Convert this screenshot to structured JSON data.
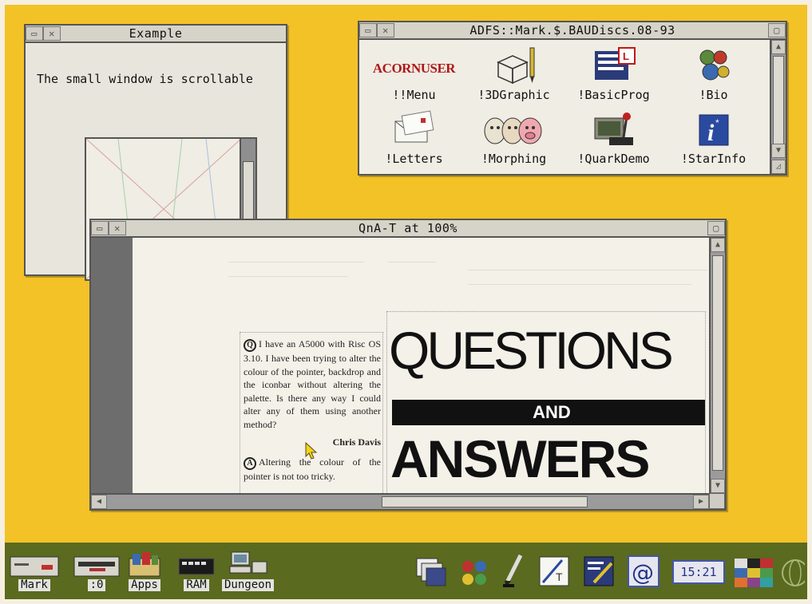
{
  "desktop": {
    "background_color": "#f2c227"
  },
  "example_window": {
    "title": "Example",
    "message": "The small window is scrollable"
  },
  "filer_window": {
    "title": "ADFS::Mark.$.BAUDiscs.08-93",
    "logo_text": "ACORNUSER",
    "items": [
      {
        "label": "!!Menu",
        "icon": "acorn-user-logo"
      },
      {
        "label": "!3DGraphic",
        "icon": "wireframe-box-pencil-icon"
      },
      {
        "label": "!BasicProg",
        "icon": "basic-program-icon"
      },
      {
        "label": "!Bio",
        "icon": "gears-icon"
      },
      {
        "label": "!Letters",
        "icon": "envelope-letters-icon"
      },
      {
        "label": "!Morphing",
        "icon": "morphing-faces-icon"
      },
      {
        "label": "!QuarkDemo",
        "icon": "joystick-icon"
      },
      {
        "label": "!StarInfo",
        "icon": "info-icon"
      }
    ]
  },
  "draw_window": {
    "title": "QnA-T at 100%",
    "article": {
      "question_marker": "Q",
      "question": "I have an A5000 with Risc OS 3.10. I have been trying to alter the colour of the pointer, backdrop and the iconbar without altering the palette. Is there any way I could alter any of them using another method?",
      "author": "Chris Davis",
      "answer_marker": "A",
      "answer": "Altering the colour of the pointer is not too tricky."
    },
    "heading": {
      "line1": "QUESTIONS",
      "line2": "AND",
      "line3": "ANSWERS"
    }
  },
  "iconbar": {
    "left_items": [
      {
        "label": "Mark",
        "icon": "floppy-drive-icon"
      },
      {
        "label": ":0",
        "icon": "disc-drive-icon"
      },
      {
        "label": "Apps",
        "icon": "apps-folder-icon"
      },
      {
        "label": "RAM",
        "icon": "ram-disc-icon"
      },
      {
        "label": "Dungeon",
        "icon": "network-computer-icon"
      }
    ],
    "right_items": [
      {
        "icon": "windows-stack-icon"
      },
      {
        "icon": "paint-palette-icon"
      },
      {
        "icon": "pen-nib-icon"
      },
      {
        "icon": "draw-icon"
      },
      {
        "icon": "edit-icon"
      },
      {
        "icon": "at-sign-icon"
      },
      {
        "icon": "palette-icon"
      },
      {
        "icon": "globe-icon"
      }
    ],
    "clock": "15:21"
  }
}
